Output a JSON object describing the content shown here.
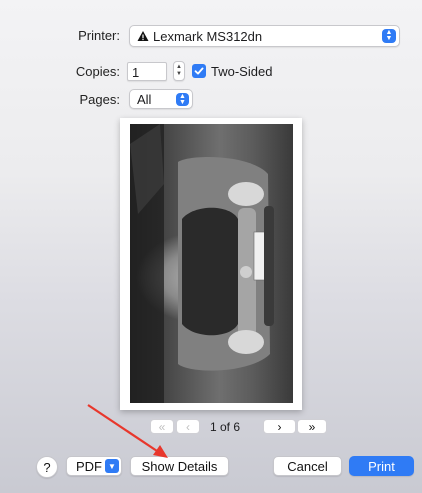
{
  "printer": {
    "label": "Printer:",
    "value": "Lexmark MS312dn",
    "icon": "printer-warning-icon"
  },
  "copies": {
    "label": "Copies:",
    "value": "1",
    "two_sided_label": "Two-Sided",
    "two_sided_checked": true
  },
  "pages": {
    "label": "Pages:",
    "value": "All"
  },
  "preview": {
    "page_indicator": "1 of 6"
  },
  "buttons": {
    "help": "?",
    "pdf": "PDF",
    "show_details": "Show Details",
    "cancel": "Cancel",
    "print": "Print"
  },
  "colors": {
    "accent": "#2f7bf5",
    "annotation_arrow": "#e8372c"
  }
}
